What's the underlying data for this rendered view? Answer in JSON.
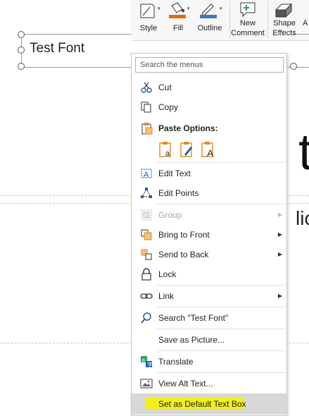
{
  "ribbon": {
    "style_label": "Style",
    "fill_label": "Fill",
    "outline_label": "Outline",
    "new_comment_line1": "New",
    "new_comment_line2": "Comment",
    "shape_effects_line1": "Shape",
    "shape_effects_line2": "Effects",
    "cut_off_label": "A",
    "fill_color": "#e46c0a",
    "outline_color": "#4472c4",
    "comment_color": "#2e9e5b"
  },
  "slide": {
    "textbox_text": "Test Font",
    "big_partial_char": "t",
    "partial_text": "lic"
  },
  "menu": {
    "search_placeholder": "Search the menus",
    "items": [
      {
        "label": "Cut",
        "icon": "scissors-icon"
      },
      {
        "label": "Copy",
        "icon": "copy-icon"
      },
      {
        "label": "Paste Options:",
        "icon": "clipboard-icon"
      },
      {
        "label": "Edit Text",
        "icon": "edit-text-icon"
      },
      {
        "label": "Edit Points",
        "icon": "edit-points-icon"
      },
      {
        "label": "Group",
        "icon": "group-icon",
        "disabled": true
      },
      {
        "label": "Bring to Front",
        "icon": "bring-to-front-icon"
      },
      {
        "label": "Send to Back",
        "icon": "send-to-back-icon"
      },
      {
        "label": "Lock",
        "icon": "lock-icon"
      },
      {
        "label": "Link",
        "icon": "link-icon"
      },
      {
        "label": "Search \"Test Font\"",
        "icon": "search-icon"
      },
      {
        "label": "Save as Picture...",
        "icon": ""
      },
      {
        "label": "Translate",
        "icon": "translate-icon"
      },
      {
        "label": "View Alt Text...",
        "icon": "alt-text-icon"
      },
      {
        "label": "Set as Default Text Box",
        "icon": "",
        "highlighted": true
      }
    ],
    "highlight_color": "#f2ef1c",
    "accent_color": "#e08a1e",
    "icon_blue": "#1f5fa8"
  }
}
